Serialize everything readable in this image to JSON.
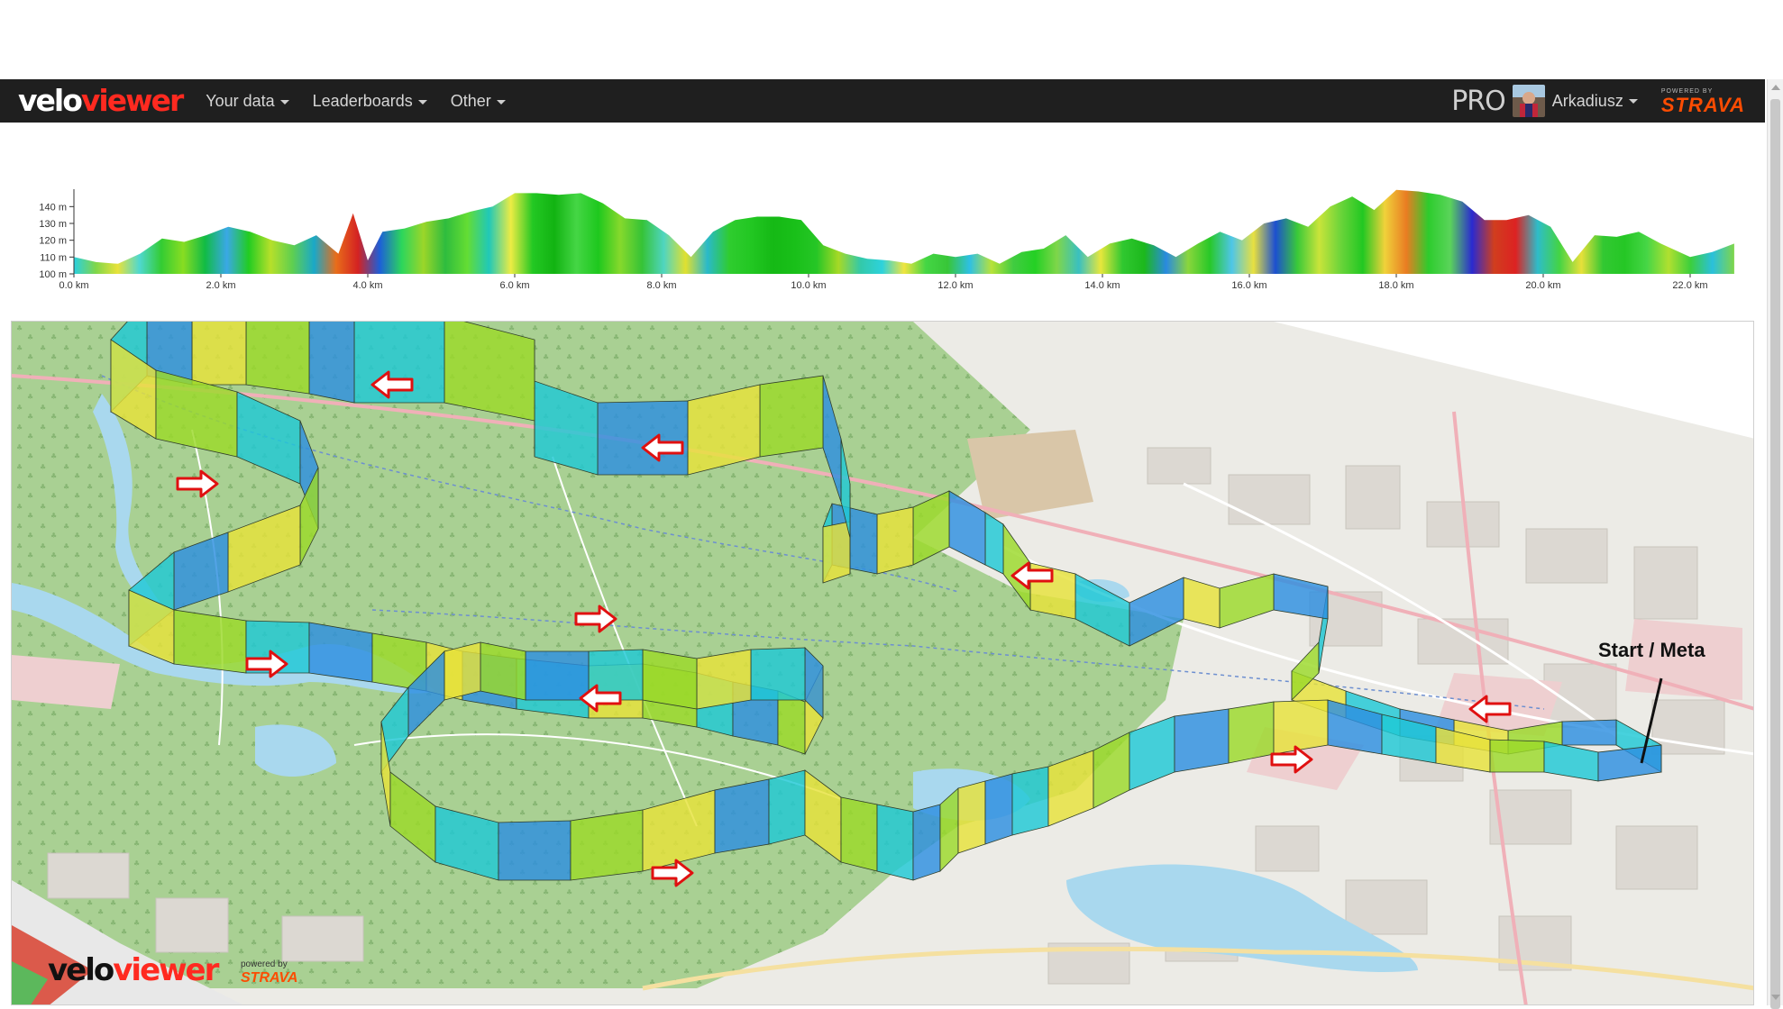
{
  "brand": {
    "velo": "velo",
    "viewer": "viewer"
  },
  "nav": {
    "items": [
      {
        "label": "Your data"
      },
      {
        "label": "Leaderboards"
      },
      {
        "label": "Other"
      }
    ]
  },
  "user": {
    "pro": "PRO",
    "name": "Arkadiusz"
  },
  "strava": {
    "powered": "POWERED BY",
    "name": "STRAVA"
  },
  "elevation_profile": {
    "y_ticks": [
      "140 m",
      "130 m",
      "120 m",
      "110 m",
      "100 m"
    ],
    "x_ticks": [
      "0.0 km",
      "2.0 km",
      "4.0 km",
      "6.0 km",
      "8.0 km",
      "10.0 km",
      "12.0 km",
      "14.0 km",
      "16.0 km",
      "18.0 km",
      "20.0 km",
      "22.0 km"
    ],
    "distance_km": [
      0,
      0.3,
      0.6,
      0.9,
      1.2,
      1.5,
      1.8,
      2.1,
      2.4,
      2.7,
      3.0,
      3.3,
      3.6,
      3.8,
      4.0,
      4.2,
      4.5,
      4.8,
      5.1,
      5.4,
      5.7,
      6.0,
      6.3,
      6.6,
      6.9,
      7.2,
      7.5,
      7.8,
      8.1,
      8.4,
      8.7,
      9.0,
      9.3,
      9.6,
      9.9,
      10.2,
      10.5,
      10.8,
      11.1,
      11.4,
      11.7,
      12.0,
      12.3,
      12.6,
      12.9,
      13.2,
      13.5,
      13.8,
      14.1,
      14.4,
      14.7,
      15.0,
      15.3,
      15.6,
      15.9,
      16.2,
      16.5,
      16.8,
      17.1,
      17.4,
      17.7,
      18.0,
      18.3,
      18.6,
      18.9,
      19.2,
      19.5,
      19.8,
      20.1,
      20.4,
      20.7,
      21.0,
      21.3,
      21.6,
      22.0,
      22.3,
      22.6
    ],
    "elevation_m": [
      110,
      107,
      106,
      112,
      121,
      119,
      123,
      128,
      125,
      120,
      117,
      123,
      112,
      136,
      108,
      125,
      127,
      131,
      133,
      137,
      140,
      148,
      148,
      147,
      148,
      142,
      133,
      132,
      123,
      110,
      125,
      132,
      134,
      134,
      132,
      117,
      112,
      109,
      108,
      106,
      112,
      110,
      112,
      106,
      113,
      115,
      123,
      110,
      118,
      121,
      117,
      110,
      118,
      125,
      120,
      130,
      133,
      128,
      140,
      146,
      138,
      150,
      149,
      147,
      143,
      132,
      132,
      135,
      128,
      107,
      123,
      122,
      125,
      118,
      110,
      113,
      118
    ],
    "gradient_colors": [
      "#2ad0e0",
      "#7fd64a",
      "#e8e23a",
      "#4fd8d0",
      "#33cc33",
      "#88dd22",
      "#11bb44",
      "#3aa8e6",
      "#22cc22",
      "#b6e02a",
      "#5fcf4f",
      "#1aa8c8",
      "#e86d1a",
      "#d42222",
      "#1d5fd8",
      "#2bd65c",
      "#9bd629",
      "#2ebc3e",
      "#64dd33",
      "#20c8b8",
      "#ecec44",
      "#23c823",
      "#12b312",
      "#45d645",
      "#1ec81e",
      "#86d92c",
      "#36c336",
      "#4fd5c0",
      "#e0e030",
      "#2ab9c9",
      "#2fcc2f",
      "#22c722",
      "#15b915",
      "#19c019",
      "#26c626",
      "#a6d926",
      "#33c9a9",
      "#2dd2dc",
      "#f0e440",
      "#44d644",
      "#38c638",
      "#2ec0e4",
      "#b8e23a",
      "#41cc41",
      "#24d024",
      "#7fd64a",
      "#3ac0c0",
      "#e7e73c",
      "#30c830",
      "#1cb81c",
      "#2a8ae0",
      "#8ad63c",
      "#28c828",
      "#4ec6e8",
      "#e8e040",
      "#1c4fd0",
      "#39c939",
      "#c9e43a",
      "#6ad43a",
      "#22c822",
      "#f0d23a",
      "#e97c22",
      "#2dcc2d",
      "#5ad45a",
      "#2a2ad0",
      "#d03e1e",
      "#dd2222",
      "#2ebcc9",
      "#44d444",
      "#e7e03a",
      "#32c832",
      "#25c725",
      "#46d646",
      "#b0e030",
      "#3ccf3c",
      "#2ac0dc",
      "#7fd64a"
    ]
  },
  "map": {
    "start_label": "Start / Meta",
    "route_colors": [
      "#1fc8d6",
      "#3bd43b",
      "#e6e23b",
      "#17b517",
      "#2d8fe0",
      "#d93a1a",
      "#9bd92a",
      "#22c9a8"
    ]
  },
  "watermark": {
    "velo": "velo",
    "viewer": "viewer",
    "powered": "powered by",
    "strava": "STRAVA"
  }
}
